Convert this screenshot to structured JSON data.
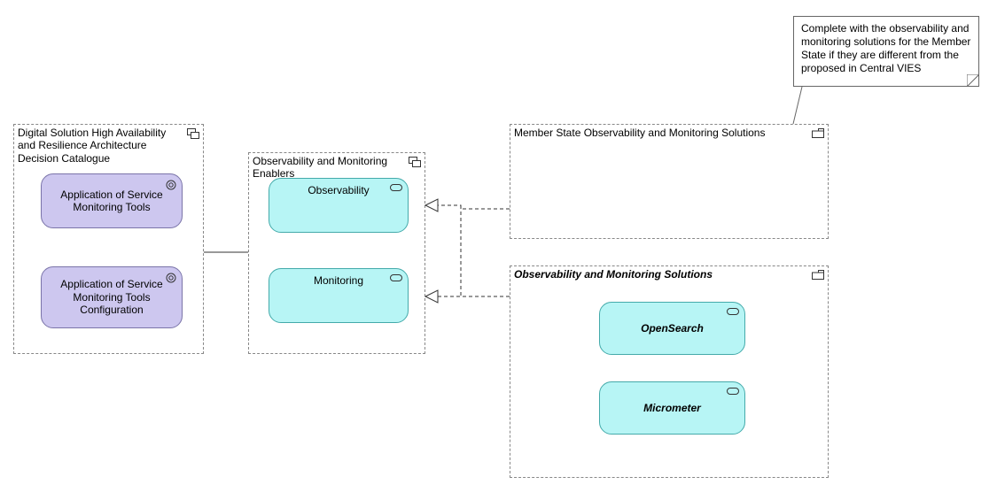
{
  "note": {
    "text": "Complete with the observability and monitoring solutions for the Member State if they are different from the proposed in Central VIES"
  },
  "groups": {
    "catalogue": {
      "title": "Digital Solution High Availability and Resilience Architecture Decision Catalogue"
    },
    "enablers": {
      "title": "Observability and Monitoring Enablers"
    },
    "msSolutions": {
      "title": "Member State Observability and Monitoring Solutions"
    },
    "solutions": {
      "title": "Observability and Monitoring Solutions"
    }
  },
  "nodes": {
    "svcMonTools": {
      "label": "Application of Service Monitoring Tools"
    },
    "svcMonToolsCfg": {
      "label": "Application of Service Monitoring Tools Configuration"
    },
    "observability": {
      "label": "Observability"
    },
    "monitoring": {
      "label": "Monitoring"
    },
    "opensearch": {
      "label": "OpenSearch"
    },
    "micrometer": {
      "label": "Micrometer"
    }
  }
}
